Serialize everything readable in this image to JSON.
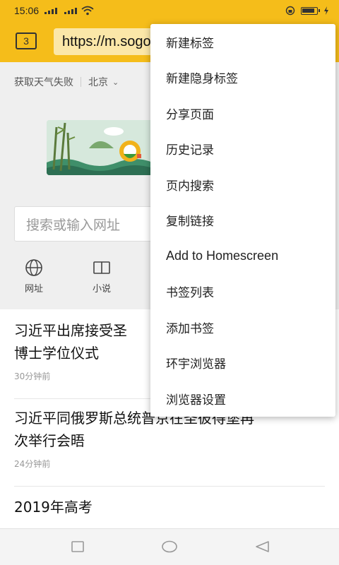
{
  "status_bar": {
    "time": "15:06"
  },
  "toolbar": {
    "tab_count": "3",
    "url": "https://m.sogou.com"
  },
  "weather": {
    "status": "获取天气失败",
    "city": "北京"
  },
  "search": {
    "placeholder": "搜索或输入网址"
  },
  "quick_links": [
    {
      "label": "网址",
      "icon": "globe-icon"
    },
    {
      "label": "小说",
      "icon": "book-icon"
    }
  ],
  "news": [
    {
      "title_line1": "习近平出席接受圣",
      "title_line2": "博士学位仪式",
      "time": "30分钟前"
    },
    {
      "title_line1": "习近平同俄罗斯总统普京在圣彼得堡再",
      "title_line2": "次举行会晤",
      "time": "24分钟前"
    },
    {
      "title_line1": "2019年高考"
    }
  ],
  "menu": {
    "items": [
      "新建标签",
      "新建隐身标签",
      "分享页面",
      "历史记录",
      "页内搜索",
      "复制链接",
      "Add to Homescreen",
      "书签列表",
      "添加书签",
      "环宇浏览器",
      "浏览器设置"
    ]
  },
  "colors": {
    "accent": "#f5bd1a",
    "url_field": "#fbe7a8"
  }
}
